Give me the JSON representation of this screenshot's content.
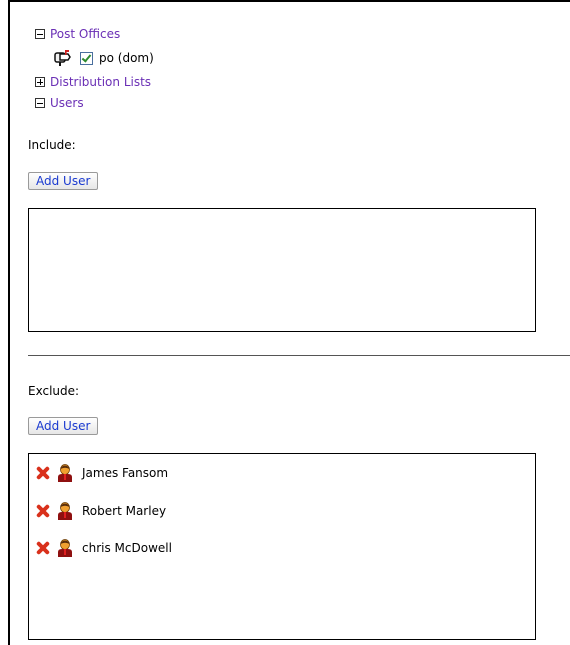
{
  "tree": {
    "post_offices_label": "Post Offices",
    "po_item_label": "po (dom)",
    "po_checked": true,
    "distribution_lists_label": "Distribution Lists",
    "users_label": "Users"
  },
  "include": {
    "label": "Include:",
    "add_button": "Add User"
  },
  "exclude": {
    "label": "Exclude:",
    "add_button": "Add User",
    "users": [
      {
        "name": "James Fansom"
      },
      {
        "name": "Robert Marley"
      },
      {
        "name": "chris McDowell"
      }
    ]
  }
}
